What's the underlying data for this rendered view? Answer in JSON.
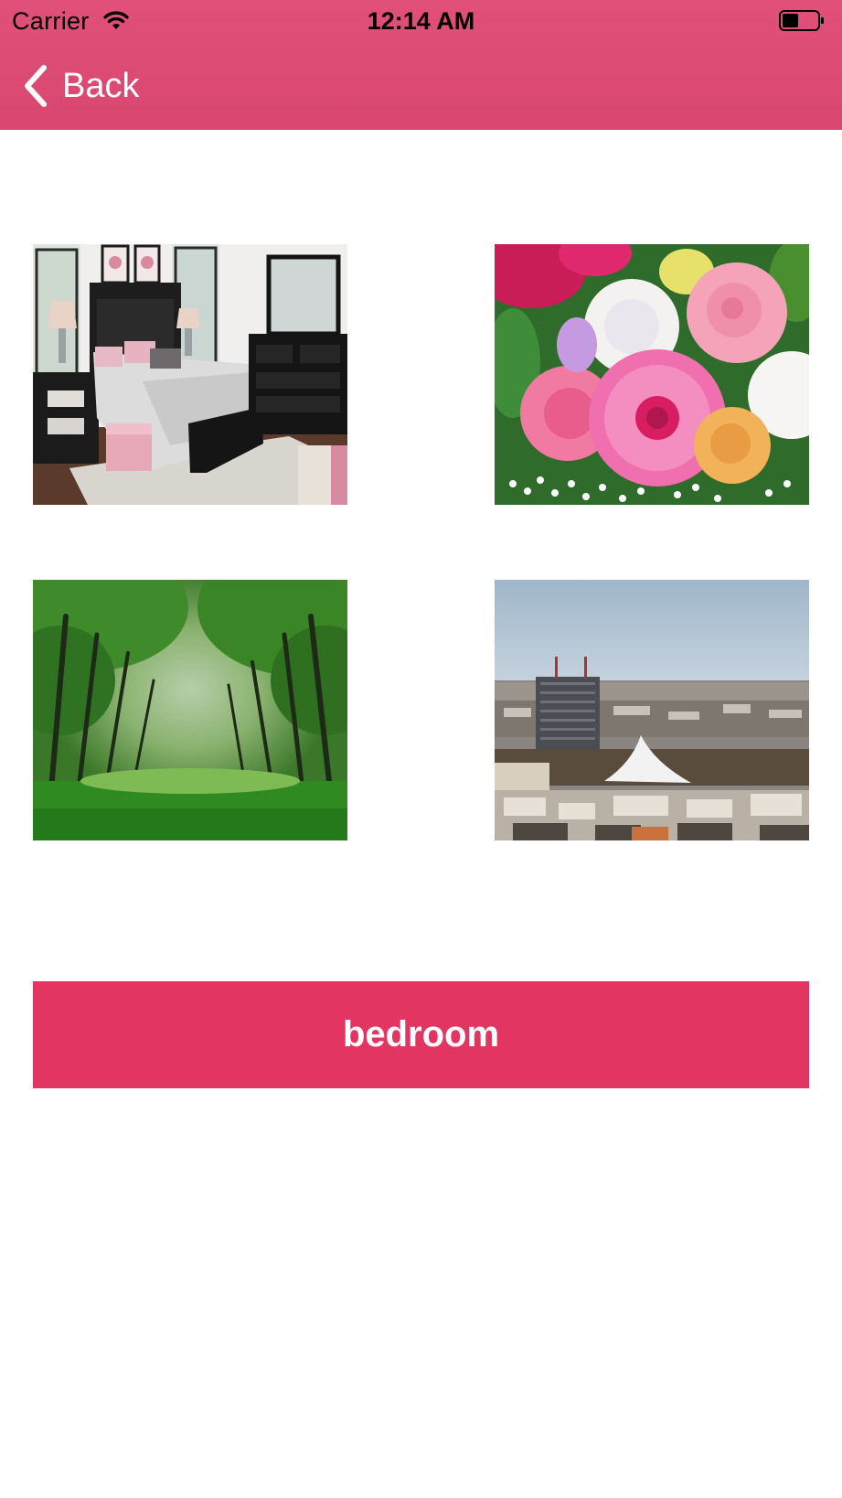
{
  "status_bar": {
    "carrier": "Carrier",
    "time": "12:14 AM",
    "wifi_icon": "wifi-icon",
    "battery_icon": "battery-icon"
  },
  "nav": {
    "back_label": "Back",
    "back_icon": "chevron-left-icon",
    "color": "#d94770"
  },
  "photos": [
    {
      "subject": "bedroom"
    },
    {
      "subject": "flowers"
    },
    {
      "subject": "forest"
    },
    {
      "subject": "city"
    }
  ],
  "answer_button": {
    "label": "bedroom",
    "color": "#e23562"
  }
}
